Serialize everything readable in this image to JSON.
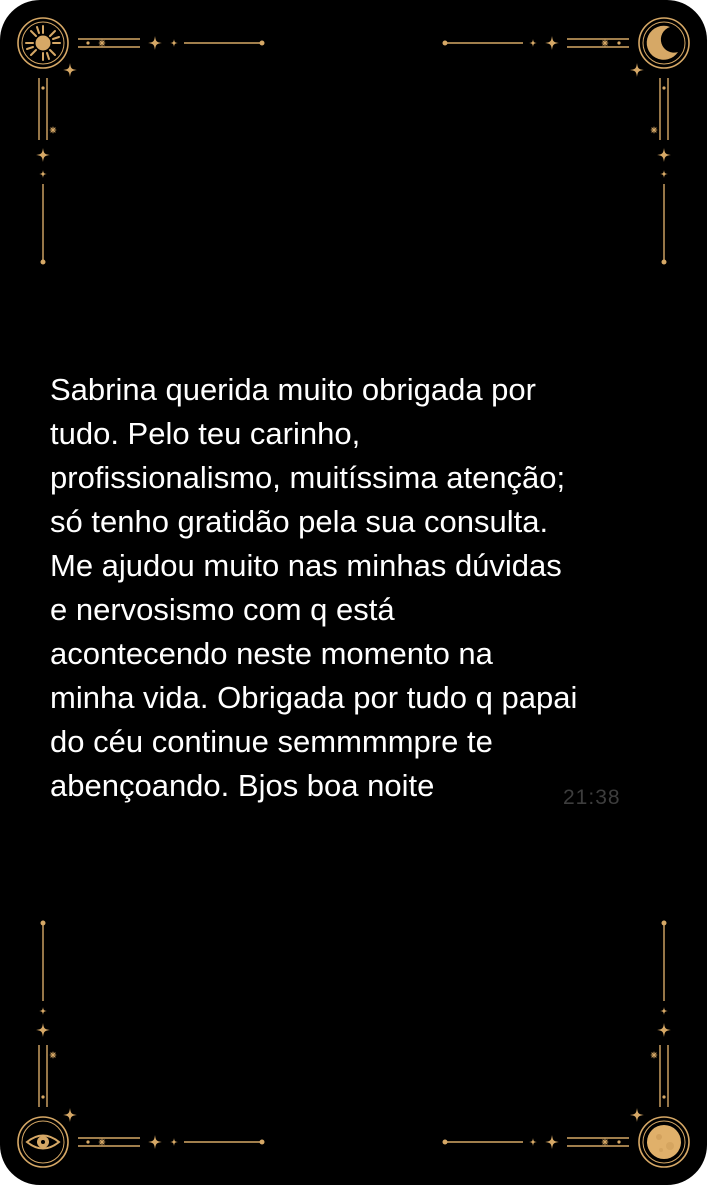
{
  "theme": {
    "background": "#000000",
    "ornament_color": "#d6a866",
    "text_color": "#ffffff",
    "timestamp_color": "#3d3d3d"
  },
  "decorations": {
    "top_left_icon": "sun-icon",
    "top_right_icon": "crescent-moon-icon",
    "bottom_left_icon": "eye-icon",
    "bottom_right_icon": "full-moon-icon"
  },
  "message": {
    "lines": [
      "Sabrina querida muito obrigada por",
      "tudo. Pelo teu carinho,",
      "profissionalismo, muitíssima atenção;",
      "só tenho gratidão pela sua consulta.",
      "Me ajudou muito nas minhas dúvidas",
      "e nervosismo com q está",
      "acontecendo neste momento na",
      "minha vida. Obrigada por tudo q papai",
      "do céu continue semmmmpre te",
      "abençoando. Bjos boa noite"
    ],
    "time": "21:38"
  }
}
